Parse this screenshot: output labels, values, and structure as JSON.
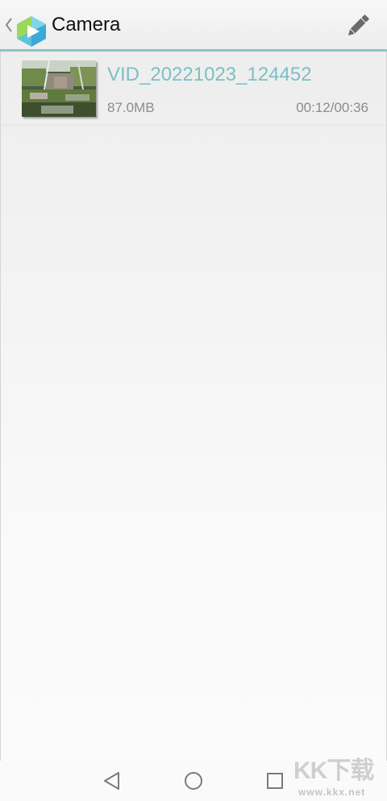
{
  "action_bar": {
    "title": "Camera",
    "icons": {
      "up": "chevron-left-icon",
      "logo": "app-logo-icon",
      "edit": "pencil-icon"
    },
    "accent_color": "#8cc6c6"
  },
  "videos": [
    {
      "name": "VID_20221023_124452",
      "size": "87.0MB",
      "duration": "00:12/00:36",
      "name_color": "#7cbfc3"
    }
  ],
  "nav_bar": {
    "icons": [
      "back-triangle-icon",
      "home-circle-icon",
      "recents-square-icon"
    ]
  },
  "watermark": {
    "text": "KK下载",
    "url": "www.kkx.net"
  }
}
